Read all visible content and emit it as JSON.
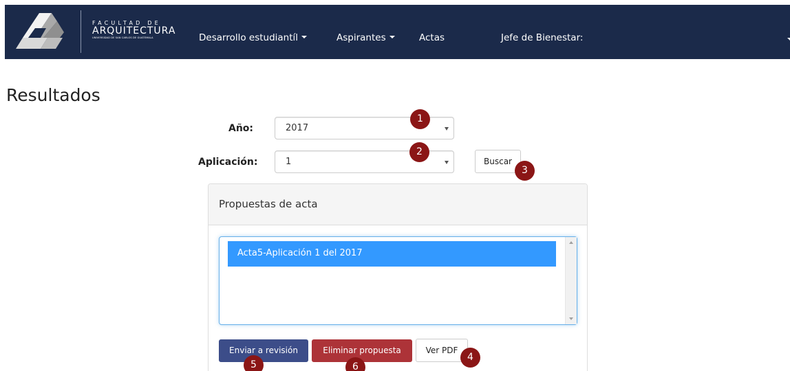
{
  "header": {
    "logo": {
      "line1": "FACULTAD DE",
      "line2": "ARQUITECTURA",
      "line3": "UNIVERSIDAD DE SAN CARLOS DE GUATEMALA"
    },
    "nav": [
      {
        "label": "Desarrollo estudiantíl",
        "has_dropdown": true
      },
      {
        "label": "Aspirantes",
        "has_dropdown": true
      },
      {
        "label": "Actas",
        "has_dropdown": false
      },
      {
        "label": "Jefe de Bienestar:",
        "has_dropdown": false
      }
    ],
    "colors": {
      "background": "#1b2a4a"
    }
  },
  "page": {
    "title": "Resultados"
  },
  "form": {
    "year_label": "Año:",
    "year_value": "2017",
    "application_label": "Aplicación:",
    "application_value": "1",
    "search_label": "Buscar"
  },
  "panel": {
    "title": "Propuestas de acta",
    "items": [
      "Acta5-Aplicación 1 del 2017"
    ],
    "selected_index": 0
  },
  "actions": {
    "send_review_label": "Enviar a revisión",
    "delete_label": "Eliminar propuesta",
    "view_pdf_label": "Ver PDF"
  },
  "badges": [
    "1",
    "2",
    "3",
    "4",
    "5",
    "6"
  ],
  "colors": {
    "primary": "#3c4d89",
    "danger": "#ad3338",
    "badge": "#8b1616",
    "selection": "#3399ff"
  }
}
